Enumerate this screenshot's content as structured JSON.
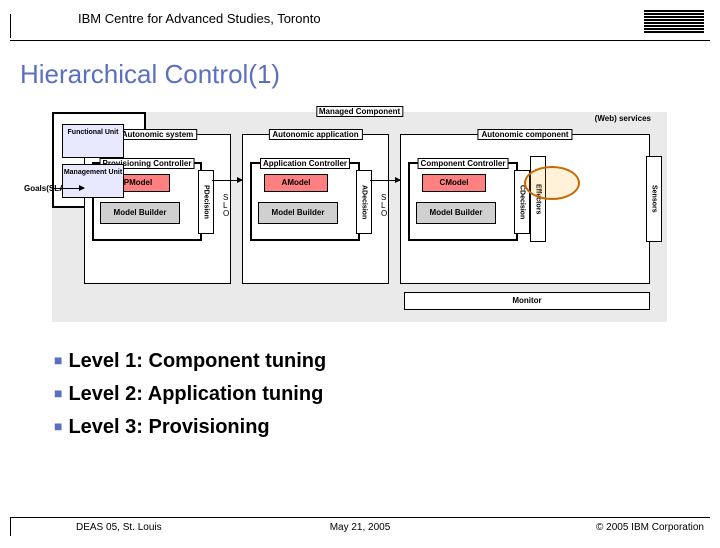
{
  "header": {
    "title": "IBM Centre for Advanced Studies, Toronto",
    "logo": "IBM"
  },
  "slide": {
    "title": "Hierarchical Control(1)"
  },
  "diagram": {
    "goals_label": "Goals(SLAs)",
    "web_services_label": "(Web) services",
    "layers": {
      "autonomic_system": "Autonomic system",
      "autonomic_application": "Autonomic application",
      "autonomic_component": "Autonomic component"
    },
    "controllers": {
      "provisioning": {
        "title": "Provisioning Controller",
        "model": "PModel",
        "builder": "Model Builder",
        "decision": "PDecision"
      },
      "application": {
        "title": "Application Controller",
        "model": "AModel",
        "builder": "Model Builder",
        "decision": "ADecision"
      },
      "component": {
        "title": "Component Controller",
        "model": "CModel",
        "builder": "Model Builder",
        "decision": "CDecision"
      }
    },
    "slo": {
      "line1": "S",
      "line2": "L",
      "line3": "O"
    },
    "managed_component": {
      "title": "Managed Component",
      "functional": "Functional Unit",
      "management": "Management Unit"
    },
    "effectors": "Effectors",
    "sensors": "Sensors",
    "monitor": "Monitor"
  },
  "bullets": [
    "Level 1: Component tuning",
    "Level 2: Application tuning",
    "Level 3: Provisioning"
  ],
  "footer": {
    "left": "DEAS 05, St. Louis",
    "center": "May 21, 2005",
    "right": "© 2005 IBM Corporation"
  }
}
